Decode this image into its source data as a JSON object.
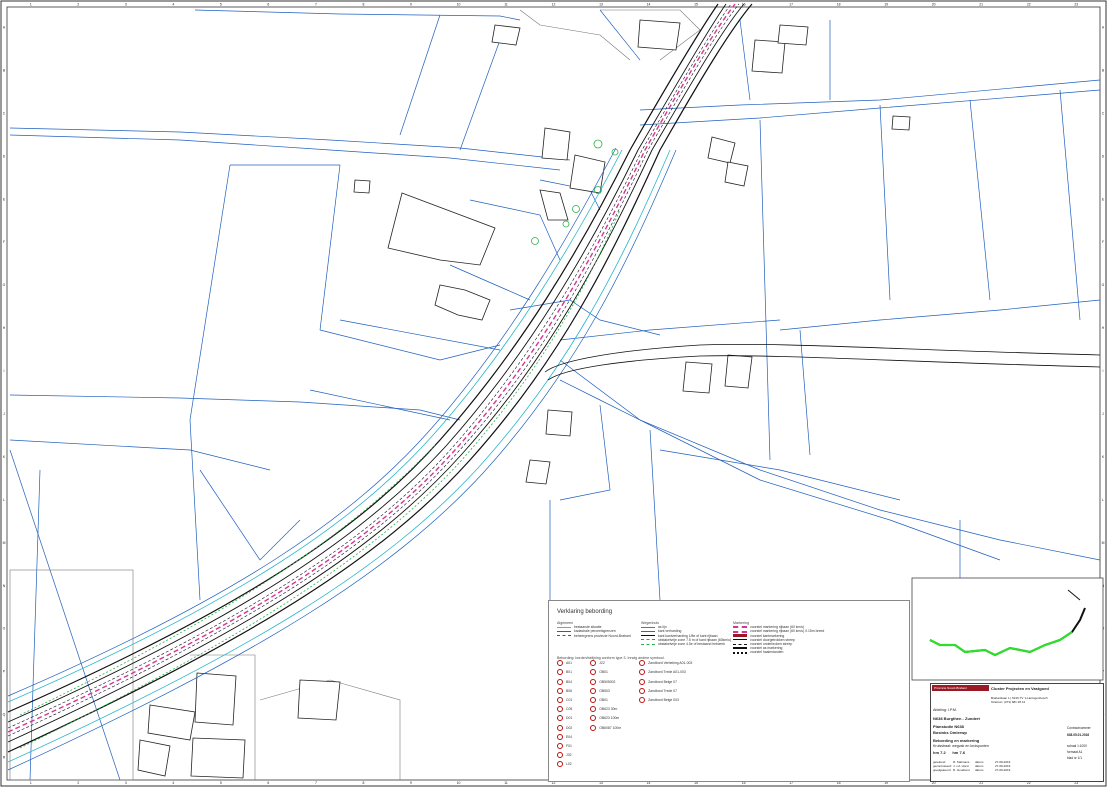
{
  "colors": {
    "parcel": "#1f5fbf",
    "building": "#222222",
    "road_edge": "#111111",
    "marking_pink": "#d6349a",
    "verge_green": "#2bb24c",
    "cyan": "#2ab5c9",
    "accent_red": "#9a1a24"
  },
  "frame": {
    "top_ticks": [
      "1",
      "2",
      "3",
      "4",
      "5",
      "6",
      "7",
      "8",
      "9",
      "10",
      "11",
      "12",
      "13",
      "14",
      "15",
      "16",
      "17",
      "18",
      "19",
      "20",
      "21",
      "22",
      "23"
    ],
    "side_ticks": [
      "A",
      "B",
      "C",
      "D",
      "E",
      "F",
      "G",
      "H",
      "I",
      "J",
      "K",
      "L",
      "M",
      "N",
      "O",
      "P",
      "Q",
      "R"
    ]
  },
  "legend": {
    "title": "Verklaring bebording",
    "col1_head": "Algemeen",
    "col1_items": [
      "bestaande situatie",
      "kadastrale perceelsgrenzen",
      "beheergrens provincie Noord-Brabant"
    ],
    "col2_head": "Wegenhuis",
    "col2_items": [
      "as lijn",
      "kant verharding",
      "kant kantverharding 1/8e of kant rijbaan",
      "obstakelvrije zone 7.5 m of kant rijbaan (60km/u)",
      "obstakelvrije zone 4.5e of bestaand hekwerk"
    ],
    "col3_head": "Markering",
    "col3_items": [
      "voorstel markering rijbaan (60 km/u)",
      "voorstel markering rijbaan (60 km/u) 0.15m breed",
      "voorstel kantmarkering",
      "voorstel doorgetrokken streep",
      "voorstel onderbroken streep",
      "voorstel as markering",
      "voorstel haaientanden"
    ],
    "signs_head": "Bebording: borden/belijning conform type 3. Inrwig andere symbool.",
    "signs_items": [
      "A01",
      "B01",
      "B04",
      "B06",
      "C01",
      "C05",
      "D01",
      "D02",
      "E04",
      "F01",
      "J32",
      "L02"
    ],
    "signs_items2": [
      "J22",
      "OB01",
      "OB505002",
      "OB503",
      "OB01",
      "OB623 30m",
      "OB623 100m",
      "OB6087 100m"
    ],
    "signs_items3": [
      "Zandbord Verbeking A01-003",
      "Zandbord Trede A01-003",
      "Zandbord Belge 07",
      "Zandbord Trede 07",
      "Zandbord Belge 003"
    ]
  },
  "titleblock": {
    "province": "Provincie Noord-Brabant",
    "cluster": "Cluster Projecten en Vastgoed",
    "address": "Brabantlaan 1 | 5216 TV 's-Hertogenbosch",
    "phone": "Telefoon: (073) 681 28 12",
    "department": "Afdeling: I.P.M.",
    "road": "N638 Burgthen - Zundert",
    "plan_line": "Planstudie N638",
    "sub_plan": "Bosinks Omlerwp",
    "subject": "Bebording en markering",
    "detail": "Kruisstraat: wegvak en kruispunten",
    "hm_from_label": "hm",
    "hm_from": "7.2",
    "hm_to_label": "hm",
    "hm_to": "7.6",
    "contract_label": "Contractnummer",
    "contract": "638.05.01.2016",
    "schaal_label": "schaal",
    "schaal": "1:1000",
    "formaat_label": "formaat",
    "formaat": "A1",
    "blad_label": "blad nr",
    "blad": "1/1",
    "table": [
      [
        "getekend",
        "R. Stalmans",
        "datum",
        "27-09-2019"
      ],
      [
        "gecontroleerd",
        "J. v.d. Horst",
        "datum",
        "27-09-2019"
      ],
      [
        "goedgekeurd",
        "R. Goudsmit",
        "datum",
        "27-09-2019"
      ]
    ]
  },
  "buildings": [
    "house-1",
    "house-2",
    "house-3",
    "house-4",
    "house-5",
    "house-6",
    "hall-1",
    "house-7",
    "house-8",
    "house-9"
  ]
}
